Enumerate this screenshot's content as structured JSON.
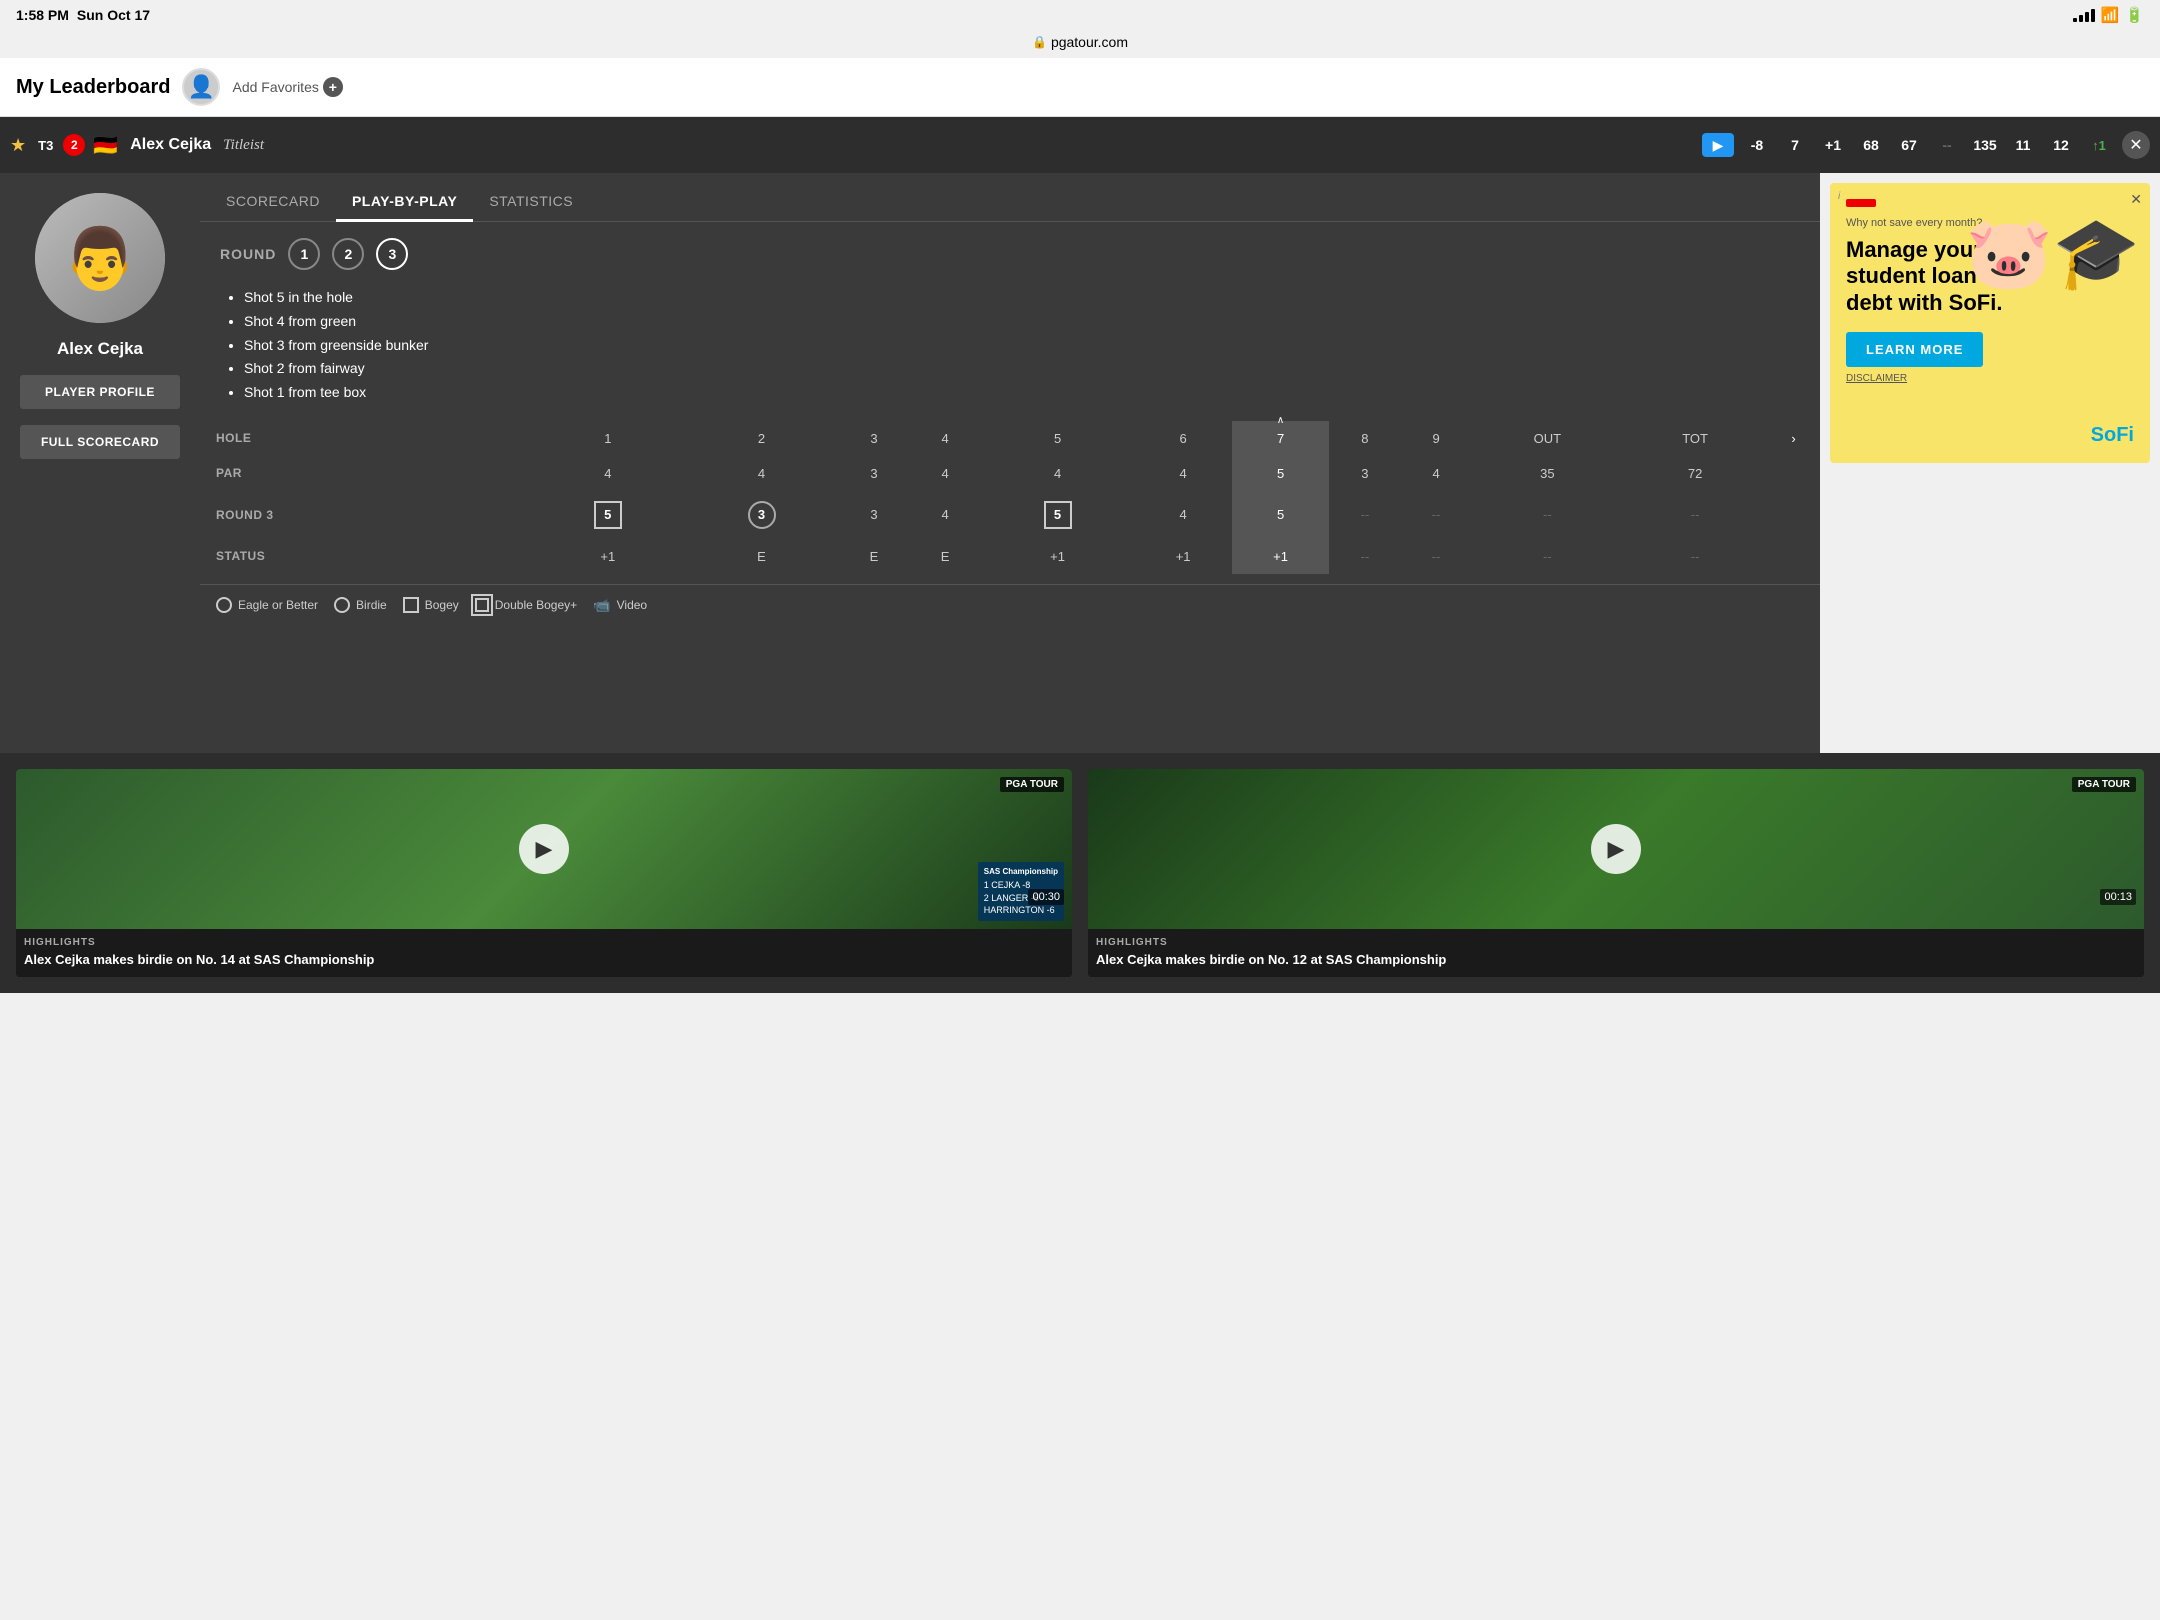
{
  "statusBar": {
    "time": "1:58 PM",
    "date": "Sun Oct 17",
    "url": "pgatour.com"
  },
  "header": {
    "title": "My Leaderboard",
    "addFavoritesLabel": "Add Favorites"
  },
  "playerBanner": {
    "position": "T3",
    "strokesBack": "2",
    "countryFlag": "🇩🇪",
    "playerName": "Alex Cejka",
    "brand": "Titleist",
    "score": "-8",
    "stat1": "7",
    "stat2": "+1",
    "round1": "68",
    "round2": "67",
    "dash": "--",
    "total": "135",
    "holes1": "11",
    "holes2": "12",
    "movement": "↑1"
  },
  "tabs": {
    "scorecard": "SCORECARD",
    "playByPlay": "PLAY-BY-PLAY",
    "statistics": "STATISTICS",
    "activeTab": "playByPlay"
  },
  "playByPlay": {
    "roundLabel": "ROUND",
    "rounds": [
      "1",
      "2",
      "3"
    ],
    "activeRound": "3",
    "shots": [
      "Shot 5 in the hole",
      "Shot 4 from green",
      "Shot 3 from greenside bunker",
      "Shot 2 from fairway",
      "Shot 1 from tee box"
    ]
  },
  "scorecard": {
    "holes": [
      "HOLE",
      "1",
      "2",
      "3",
      "4",
      "5",
      "6",
      "7",
      "8",
      "9",
      "OUT",
      "TOT"
    ],
    "par": [
      "PAR",
      "4",
      "4",
      "3",
      "4",
      "4",
      "4",
      "5",
      "3",
      "4",
      "35",
      "72"
    ],
    "round3": [
      "ROUND 3",
      "5",
      "3",
      "3",
      "4",
      "5",
      "4",
      "5",
      "--",
      "--",
      "--",
      "--"
    ],
    "status": [
      "STATUS",
      "+1",
      "E",
      "E",
      "E",
      "+1",
      "+1",
      "+1",
      "--",
      "--",
      "--",
      "--"
    ],
    "activeHole": 7
  },
  "legend": {
    "eagleLabel": "Eagle or Better",
    "birdieLabel": "Birdie",
    "bogeyLabel": "Bogey",
    "doubleBogeyLabel": "Double Bogey+",
    "videoLabel": "Video"
  },
  "ad": {
    "tagline": "Why not save every month?",
    "headline": "Manage your student loan debt with SoFi.",
    "ctaLabel": "LEARN MORE",
    "disclaimer": "DISCLAIMER",
    "brand": "SoFi"
  },
  "videos": [
    {
      "tag": "HIGHLIGHTS",
      "title": "Alex Cejka makes birdie on No. 14 at SAS Championship",
      "duration": "00:30",
      "pgaBadge": "PGA TOUR"
    },
    {
      "tag": "HIGHLIGHTS",
      "title": "Alex Cejka makes birdie on No. 12 at SAS Championship",
      "duration": "00:13",
      "pgaBadge": "PGA TOUR"
    }
  ],
  "buttons": {
    "playerProfile": "PLAYER PROFILE",
    "fullScorecard": "FULL SCORECARD"
  }
}
